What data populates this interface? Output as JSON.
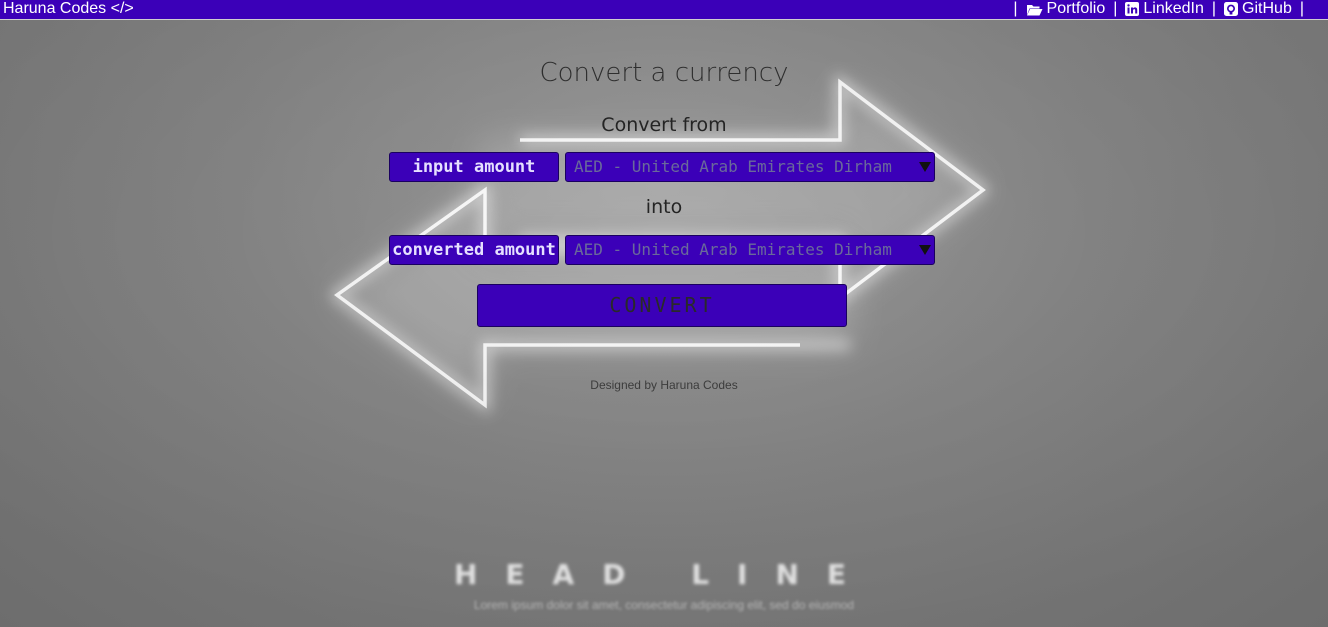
{
  "nav": {
    "brand": "Haruna Codes </>",
    "separator": "|",
    "links": [
      {
        "label": "Portfolio",
        "icon": "folder-open-icon"
      },
      {
        "label": "LinkedIn",
        "icon": "linkedin-icon"
      },
      {
        "label": "GitHub",
        "icon": "github-icon"
      }
    ]
  },
  "converter": {
    "title": "Convert a currency",
    "from_label": "Convert from",
    "into_label": "into",
    "input_amount_placeholder": "input amount",
    "converted_amount_placeholder": "converted amount",
    "from_currency": "AED - United Arab Emirates Dirham",
    "to_currency": "AED - United Arab Emirates Dirham",
    "convert_label": "CONVERT"
  },
  "footer": {
    "credit": "Designed by Haruna Codes"
  },
  "background": {
    "headline": "HEAD LINE",
    "headline_sub": "Lorem ipsum dolor sit amet, consectetur adipiscing elit, sed do eiusmod"
  },
  "colors": {
    "accent": "#3b00b8",
    "navbar_text": "#ffffff",
    "page_background": "#8c8c8c"
  }
}
